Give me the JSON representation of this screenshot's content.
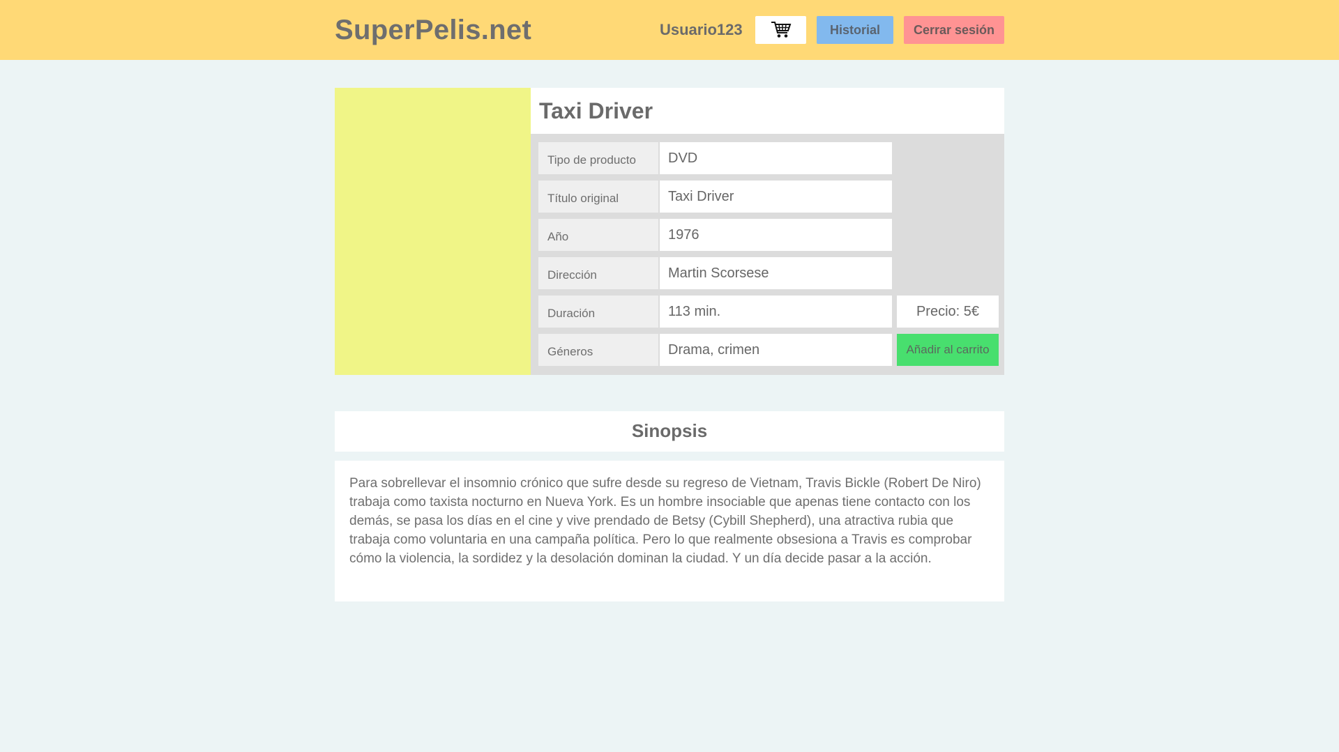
{
  "header": {
    "logo": "SuperPelis.net",
    "username": "Usuario123",
    "cart_icon": "shopping-cart-icon",
    "history_label": "Historial",
    "logout_label": "Cerrar sesión",
    "colors": {
      "background": "#ffd976",
      "history": "#82b9ee",
      "logout": "#ff9393"
    }
  },
  "product": {
    "title": "Taxi Driver",
    "details": [
      {
        "label": "Tipo de producto",
        "value": "DVD"
      },
      {
        "label": "Título original",
        "value": "Taxi Driver"
      },
      {
        "label": "Año",
        "value": "1976"
      },
      {
        "label": "Dirección",
        "value": "Martin Scorsese"
      },
      {
        "label": "Duración",
        "value": "113 min."
      },
      {
        "label": "Géneros",
        "value": "Drama, crimen"
      }
    ],
    "price": "Precio: 5€",
    "add_to_cart": "Añadir al carrito",
    "colors": {
      "poster": "#f0f587",
      "add_to_cart": "#48df6e"
    }
  },
  "sinopsis": {
    "heading": "Sinopsis",
    "text": "Para sobrellevar el insomnio crónico que sufre desde su regreso de Vietnam, Travis Bickle (Robert De Niro) trabaja como taxista nocturno en Nueva York. Es un hombre insociable que apenas tiene contacto con los demás, se pasa los días en el cine y vive prendado de Betsy (Cybill Shepherd), una atractiva rubia que trabaja como voluntaria en una campaña política. Pero lo que realmente obsesiona a Travis es comprobar cómo la violencia, la sordidez y la desolación dominan la ciudad. Y un día decide pasar a la acción."
  }
}
